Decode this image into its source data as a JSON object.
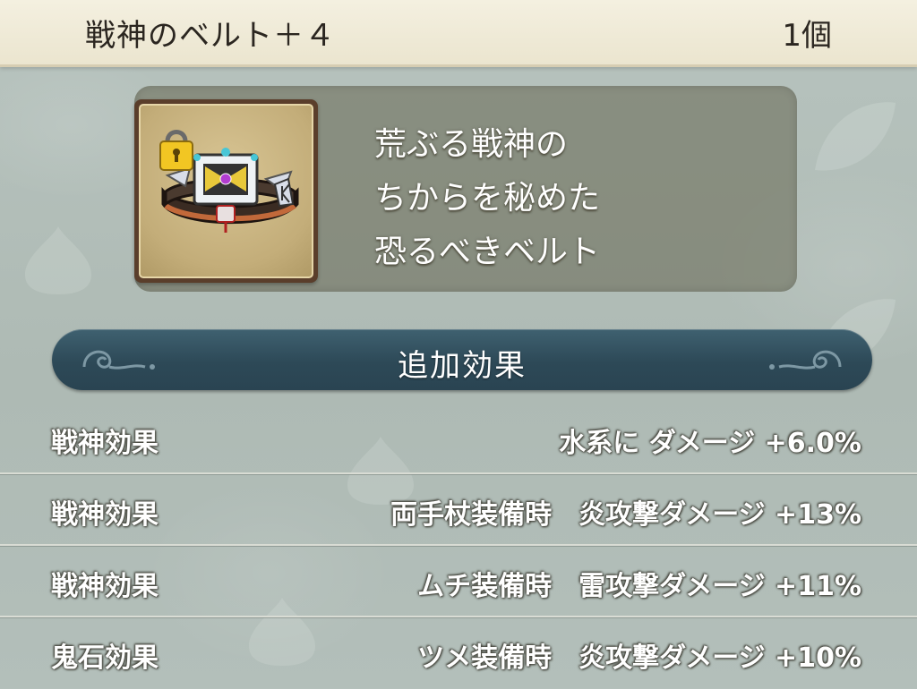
{
  "header": {
    "item_name": "戦神のベルト＋４",
    "count": "1個"
  },
  "item": {
    "icon": "belt-icon",
    "locked": true,
    "description": [
      "荒ぶる戦神の",
      "ちからを秘めた",
      "恐るべきベルト"
    ]
  },
  "section": {
    "title": "追加効果"
  },
  "effects": [
    {
      "label": "戦神効果",
      "value": "水系に ダメージ +6.0%"
    },
    {
      "label": "戦神効果",
      "value": "両手杖装備時　炎攻撃ダメージ +13%"
    },
    {
      "label": "戦神効果",
      "value": "ムチ装備時　雷攻撃ダメージ +11%"
    },
    {
      "label": "鬼石効果",
      "value": "ツメ装備時　炎攻撃ダメージ +10%"
    }
  ],
  "colors": {
    "banner": "#2d4957",
    "header_bg": "#f0ebd8",
    "panel": "#6e705c"
  }
}
